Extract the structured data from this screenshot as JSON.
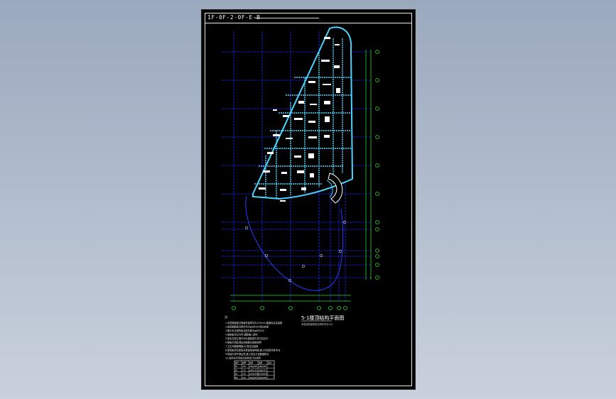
{
  "viewer": {
    "background_color": "#a9b5c6",
    "sheet_color": "#000000"
  },
  "drawing": {
    "title_block_text": "1F-0F-2-0F-E-B",
    "plan_title": "5-1楼顶结构平面图",
    "plan_subtitle": "本层结构板厚除注明外均为120",
    "notes_heading": "注:",
    "notes": [
      "1.本层楼板除注明者外板厚均为120mm,楼面标高见建施",
      "2.板底钢筋除注明外均为φ8@200双向布置",
      "3.图中未注明的板支座负筋为φ8@200",
      "4.悬挑板详见大样,钢筋锚入梁内",
      "5.梁定位除注明外均为轴线居中或与柱边平",
      "6.楼板开洞处洞边加强筋见结施说明",
      "7.卫生间楼面降板50,做法见建施",
      "8.屋面板厚及配筋见屋面层结构图,施工时应配合各专业",
      "9.预留孔洞不得后凿,施工前应与设备图核对",
      "10.其余未尽事宜见结构设计总说明"
    ],
    "table_rows": [
      [
        "编号",
        "板厚",
        "底筋",
        "面筋",
        "备注"
      ],
      [
        "B1",
        "120",
        "φ8@200",
        "φ8@200",
        "-"
      ],
      [
        "B2",
        "120",
        "φ8@150",
        "φ8@150",
        "-"
      ],
      [
        "B3",
        "150",
        "φ10@200",
        "φ10@200",
        "-"
      ],
      [
        "B4",
        "100",
        "φ8@200",
        "φ8@200",
        "-"
      ]
    ],
    "colors": {
      "grid_blue": "#1f2dff",
      "axis_green": "#27d627",
      "beam_cyan": "#4ad4ff",
      "text_white": "#ffffff"
    }
  }
}
